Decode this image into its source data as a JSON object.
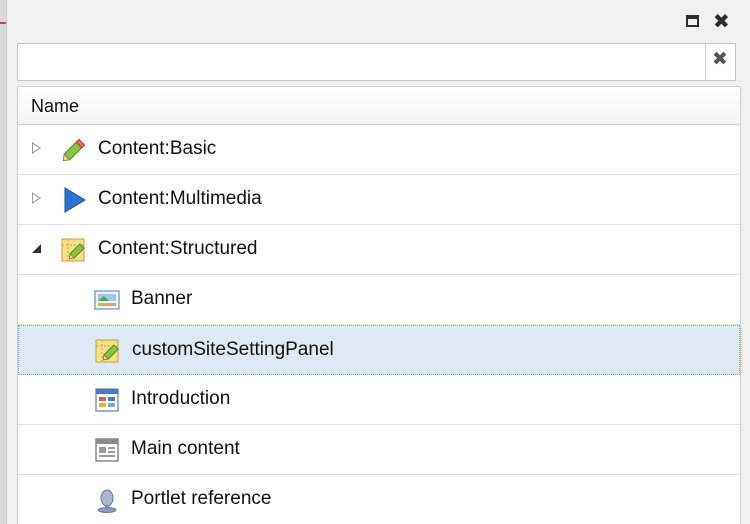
{
  "window": {
    "maximize_icon": "maximize-icon",
    "close_icon": "close-icon"
  },
  "search": {
    "value": "",
    "placeholder": "",
    "clear_icon": "clear-icon"
  },
  "grid": {
    "column_header": "Name",
    "rows": [
      {
        "label": "Content:Basic",
        "icon": "pencil-icon",
        "level": 0,
        "expander": "collapsed"
      },
      {
        "label": "Content:Multimedia",
        "icon": "play-icon",
        "level": 0,
        "expander": "collapsed"
      },
      {
        "label": "Content:Structured",
        "icon": "structured-content-icon",
        "level": 0,
        "expander": "expanded"
      },
      {
        "label": "Banner",
        "icon": "image-icon",
        "level": 1
      },
      {
        "label": "customSiteSettingPanel",
        "icon": "structured-content-icon",
        "level": 1,
        "selected": true
      },
      {
        "label": "Introduction",
        "icon": "layout-icon",
        "level": 1
      },
      {
        "label": "Main content",
        "icon": "document-icon",
        "level": 1
      },
      {
        "label": "Portlet reference",
        "icon": "portlet-icon",
        "level": 1
      }
    ]
  },
  "colors": {
    "selection": "#dfe8f5",
    "selection_border": "#7d9ed2",
    "accent_line": "#b8494e"
  }
}
